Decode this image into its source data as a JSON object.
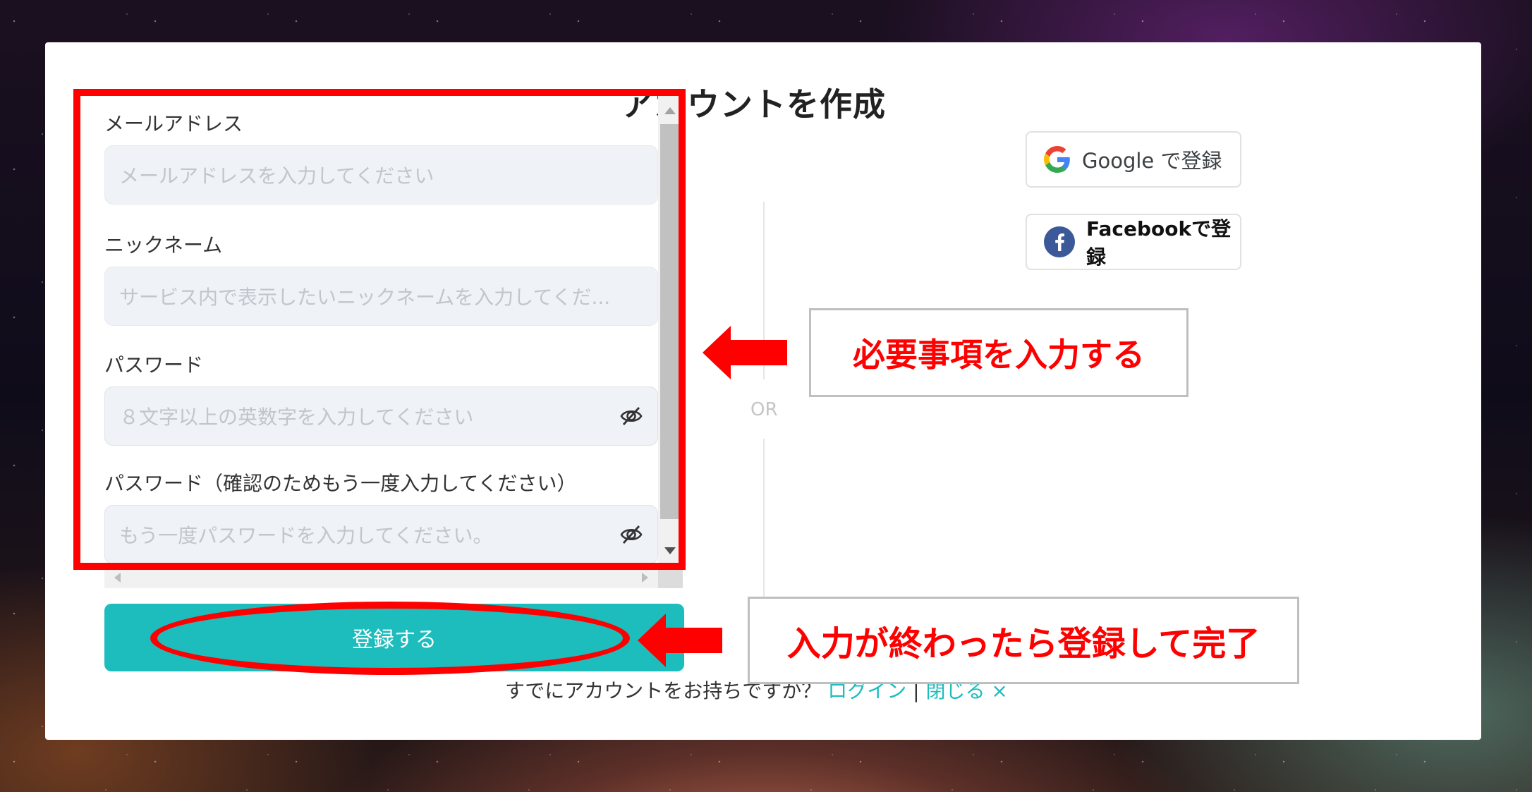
{
  "modal": {
    "title": "アカウントを作成"
  },
  "form": {
    "fields": [
      {
        "label": "メールアドレス",
        "placeholder": "メールアドレスを入力してください"
      },
      {
        "label": "ニックネーム",
        "placeholder": "サービス内で表示したいニックネームを入力してくだ..."
      },
      {
        "label": "パスワード",
        "placeholder": "８文字以上の英数字を入力してください",
        "icon": "eye-off-icon"
      },
      {
        "label": "パスワード（確認のためもう一度入力してください）",
        "placeholder": "もう一度パスワードを入力してください。",
        "icon": "eye-off-icon"
      }
    ],
    "submit_label": "登録する"
  },
  "footer": {
    "prompt": "すでにアカウントをお持ちですか？",
    "login_link": "ログイン",
    "separator": "|",
    "close_link": "閉じる ×"
  },
  "social": {
    "or_label": "OR",
    "google_label": "Google で登録",
    "facebook_label": "Facebookで登録"
  },
  "annotations": {
    "callout_fields": "必要事項を入力する",
    "callout_submit": "入力が終わったら登録して完了"
  },
  "colors": {
    "accent": "#1dbcbd",
    "annotation": "#ff0000",
    "facebook": "#3b5998"
  }
}
